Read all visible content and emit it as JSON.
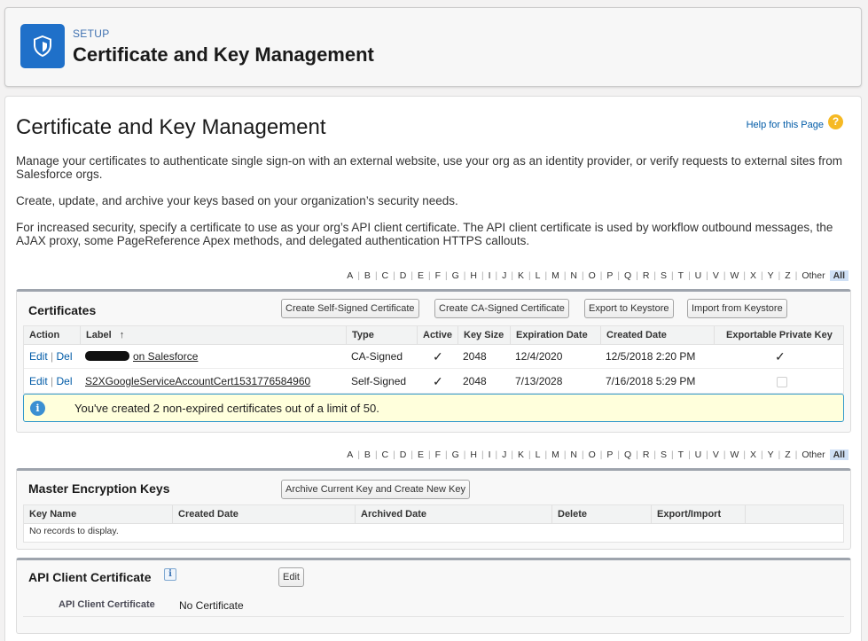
{
  "header": {
    "setup_label": "SETUP",
    "title": "Certificate and Key Management",
    "icon": "shield-icon",
    "icon_color": "#1f70c9"
  },
  "page": {
    "title": "Certificate and Key Management",
    "help_link": "Help for this Page",
    "help_icon": "?",
    "para1": "Manage your certificates to authenticate single sign-on with an external website, use your org as an identity provider, or verify requests to external sites from Salesforce orgs.",
    "para2": "Create, update, and archive your keys based on your organization’s security needs.",
    "para3": "For increased security, specify a certificate to use as your org’s API client certificate. The API client certificate is used by workflow outbound messages, the AJAX proxy, some PageReference Apex methods, and delegated authentication HTTPS callouts."
  },
  "alpha": [
    "A",
    "B",
    "C",
    "D",
    "E",
    "F",
    "G",
    "H",
    "I",
    "J",
    "K",
    "L",
    "M",
    "N",
    "O",
    "P",
    "Q",
    "R",
    "S",
    "T",
    "U",
    "V",
    "W",
    "X",
    "Y",
    "Z",
    "Other",
    "All"
  ],
  "certificates": {
    "title": "Certificates",
    "buttons": {
      "self_signed": "Create Self-Signed Certificate",
      "ca_signed": "Create CA-Signed Certificate",
      "export": "Export to Keystore",
      "import": "Import from Keystore"
    },
    "columns": {
      "action": "Action",
      "label": "Label",
      "sort_arrow": "↑",
      "type": "Type",
      "active": "Active",
      "key_size": "Key Size",
      "expiration": "Expiration Date",
      "created": "Created Date",
      "exportable": "Exportable Private Key"
    },
    "rows": [
      {
        "edit": "Edit",
        "del": "Del",
        "label": "on Salesforce",
        "type": "CA-Signed",
        "active": "✓",
        "key_size": "2048",
        "expiration": "12/4/2020",
        "created": "12/5/2018 2:20 PM",
        "exportable": "✓"
      },
      {
        "edit": "Edit",
        "del": "Del",
        "label": "S2XGoogleServiceAccountCert1531776584960",
        "type": "Self-Signed",
        "active": "✓",
        "key_size": "2048",
        "expiration": "7/13/2028",
        "created": "7/16/2018 5:29 PM",
        "exportable": ""
      }
    ],
    "info_icon": "i",
    "info_message": "You've created 2 non-expired certificates out of a limit of 50.",
    "separator": "|"
  },
  "master_keys": {
    "title": "Master Encryption Keys",
    "archive_button": "Archive Current Key and Create New Key",
    "columns": {
      "key_name": "Key Name",
      "created": "Created Date",
      "archived": "Archived Date",
      "delete": "Delete",
      "export_import": "Export/Import"
    },
    "empty": "No records to display."
  },
  "api_client": {
    "title": "API Client Certificate",
    "info_icon": "i",
    "edit_button": "Edit",
    "field_label": "API Client Certificate",
    "field_value": "No Certificate"
  }
}
